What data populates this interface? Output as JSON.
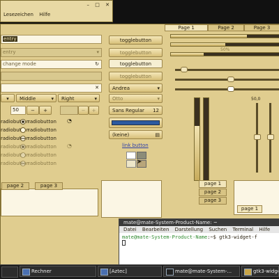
{
  "browser_menu": {
    "bookmarks": "Lesezeichen",
    "help": "Hilfe"
  },
  "notebook_tabs": [
    "Page 1",
    "Page 2",
    "Page 3"
  ],
  "entries": {
    "entry": "entry",
    "entry_disabled": "entry",
    "icon_entry_placeholder": "change mode"
  },
  "alignment_buttons": [
    "Middle",
    "Right"
  ],
  "spin_value": "50",
  "radio_label": "radiobutton",
  "toggle_label": "togglebutton",
  "combo_values": [
    "Andrea",
    "Otto"
  ],
  "font_button": {
    "family": "Sans Regular",
    "size": "12"
  },
  "file_chooser": "(keine)",
  "link_button": "link button",
  "scale": {
    "label_50": "50%",
    "v_label": "50,0"
  },
  "lower_tabs": [
    "page 2",
    "page 3"
  ],
  "right_tabs_v": [
    "page 1",
    "page 2",
    "page 3"
  ],
  "right_tabs_h": [
    "page 1"
  ],
  "progress": {
    "p1": 0.7,
    "p2": 0.5,
    "p3": 0.3
  },
  "terminal": {
    "title": "mate@mate-System-Product-Name: ~",
    "menu": [
      "Datei",
      "Bearbeiten",
      "Darstellung",
      "Suchen",
      "Terminal",
      "Hilfe"
    ],
    "prompt_user": "mate@mate-System-Product-Name",
    "prompt_path": ":~$ ",
    "command": "gtk3-widget-f"
  },
  "taskbar": [
    {
      "label": "Rechner"
    },
    {
      "label": "[Aztec]"
    },
    {
      "label": "mate@mate-System-..."
    },
    {
      "label": "gtk3-widge..."
    }
  ]
}
